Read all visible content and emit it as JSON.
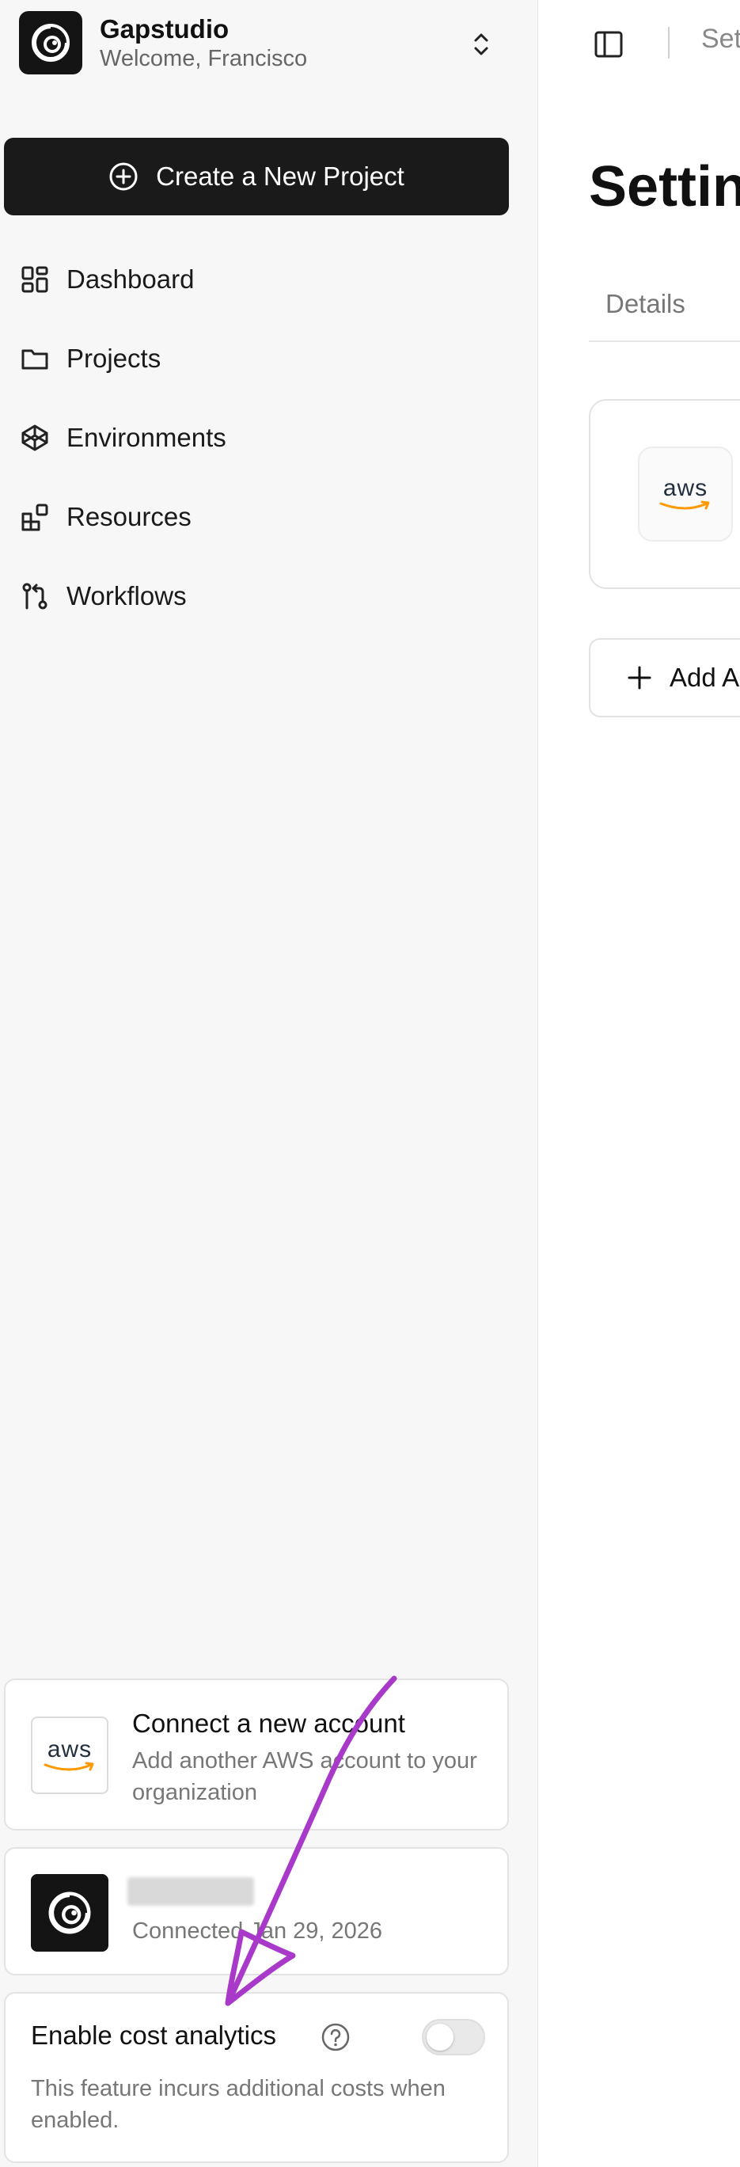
{
  "org": {
    "name": "Gapstudio",
    "welcome": "Welcome, Francisco"
  },
  "sidebar": {
    "create_label": "Create a New Project",
    "items": [
      {
        "label": "Dashboard",
        "icon": "dashboard-icon"
      },
      {
        "label": "Projects",
        "icon": "folder-icon"
      },
      {
        "label": "Environments",
        "icon": "cube-icon"
      },
      {
        "label": "Resources",
        "icon": "resources-icon"
      },
      {
        "label": "Workflows",
        "icon": "git-branch-icon"
      }
    ],
    "connect": {
      "logo_text": "aws",
      "title": "Connect a new account",
      "subtitle": "Add another AWS account to your organization"
    },
    "account": {
      "connected": "Connected Jan 29, 2026"
    },
    "cost": {
      "title": "Enable cost analytics",
      "description": "This feature incurs additional costs when enabled.",
      "enabled": false
    }
  },
  "main": {
    "breadcrumb": "Set",
    "title": "Settin",
    "tab": "Details",
    "account_logo": "aws",
    "add_label": "Add A"
  },
  "colors": {
    "dark": "#1a1a1a",
    "sidebar_bg": "#f7f7f7",
    "annotation": "#a839c9",
    "aws_smile": "#ff9900"
  }
}
